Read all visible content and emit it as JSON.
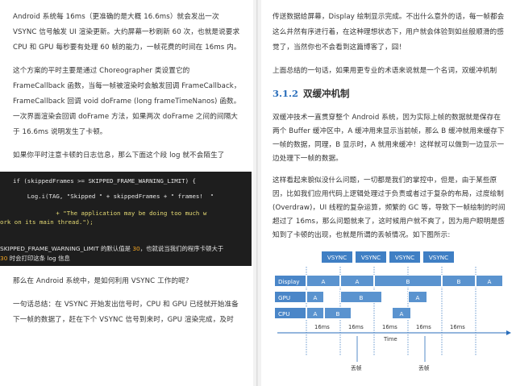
{
  "left": {
    "p1": "Android 系统每 16ms（更准确的是大概 16.6ms）就会发出一次 VSYNC 信号触发 UI 渲染更新。大约屏幕一秒刷新 60 次，也就是说要求 CPU 和 GPU 每秒要有处理 60 帧的能力，一帧花费的时间在 16ms 内。",
    "p2": "这个方案的平时主要是通过 Choreographer 类设置它的 FrameCallback 函数，当每一帧被渲染时会触发回调 FrameCallback，FrameCallback 回调 void doFrame (long frameTimeNanos) 函数。一次界面渲染会回调 doFrame 方法，如果两次 doFrame 之间的间隔大于 16.6ms 说明发生了卡顿。",
    "p3": "如果你平时注意卡顿的日志信息，那么下面这个段 log 就不会陌生了",
    "code": {
      "l1": "if (skippedFrames >= SKIPPED_FRAME_WARNING_LIMIT) {",
      "l2": "    Log.i(TAG, \"Skipped \" + skippedFrames + \" frames!  \"",
      "l3": "            + \"The application may be doing too much w",
      "l4": "ork on its main thread.\");",
      "l5a": "SKIPPED_FRAME_WARNING_LIMIT 的默认值是 ",
      "l5b": "30",
      "l5c": "，也就说当我们的程序卡顿大于",
      "l6a": "30",
      "l6b": " 时会打印这条 log 信息"
    },
    "p4": "那么在 Android 系统中，是如何利用 VSYNC 工作的呢?",
    "p5": "一句话总结：在 VSYNC 开始发出信号时，CPU 和 GPU 已经就开始准备下一帧的数据了，赶在下个 VSYNC 信号到来时，GPU 渲染完成，及时"
  },
  "right": {
    "p1": "传送数据给屏幕，Display 绘制显示完成。不出什么意外的话，每一帧都会这么井然有序进行着，在这种理想状态下，用户就会体验到如丝般顺滑的感觉了，当然你也不会看到这篇博客了，囧！",
    "p2": "上面总结的一句话，如果用更专业的术语来说就是一个名词，双缓冲机制",
    "heading_num": "3.1.2",
    "heading_text": "双缓冲机制",
    "p3": "双缓冲技术一直贯穿整个 Android 系统，因为实际上帧的数据就是保存在两个 Buffer 缓冲区中，A 缓冲用来显示当前帧，那么 B 缓冲就用来缓存下一帧的数据，同理，B 显示时，A 就用来缓冲！这样就可以做到一边显示一边处理下一帧的数据。",
    "p4": "这样看起来貌似没什么问题，一切都是我们的掌控中，但是，由于某些原因，比如我们应用代码上逻辑处理过于负责或者过于复杂的布局，过度绘制(Overdraw)，UI 线程的复杂运算，频繁的 GC 等，导致下一帧绘制的时间超过了 16ms，那么问题就来了，这时候用户就不爽了，因为用户眼明是感知到了卡顿的出现，也就是所谓的丢帧情况。如下图所示:",
    "diagram": {
      "vsync_labels": [
        "VSYNC",
        "VSYNC",
        "VSYNC",
        "VSYNC"
      ],
      "rows": [
        "Display",
        "GPU",
        "CPU"
      ],
      "display": [
        "A",
        "A",
        "B",
        "B",
        "A"
      ],
      "gpu": [
        "A",
        "B",
        "A"
      ],
      "cpu": [
        "A",
        "B",
        "A"
      ],
      "time_labels": [
        "16ms",
        "16ms",
        "16ms",
        "16ms",
        "16ms"
      ],
      "time_axis": "Time",
      "jank_labels": [
        "丢帧",
        "丢帧"
      ]
    }
  }
}
